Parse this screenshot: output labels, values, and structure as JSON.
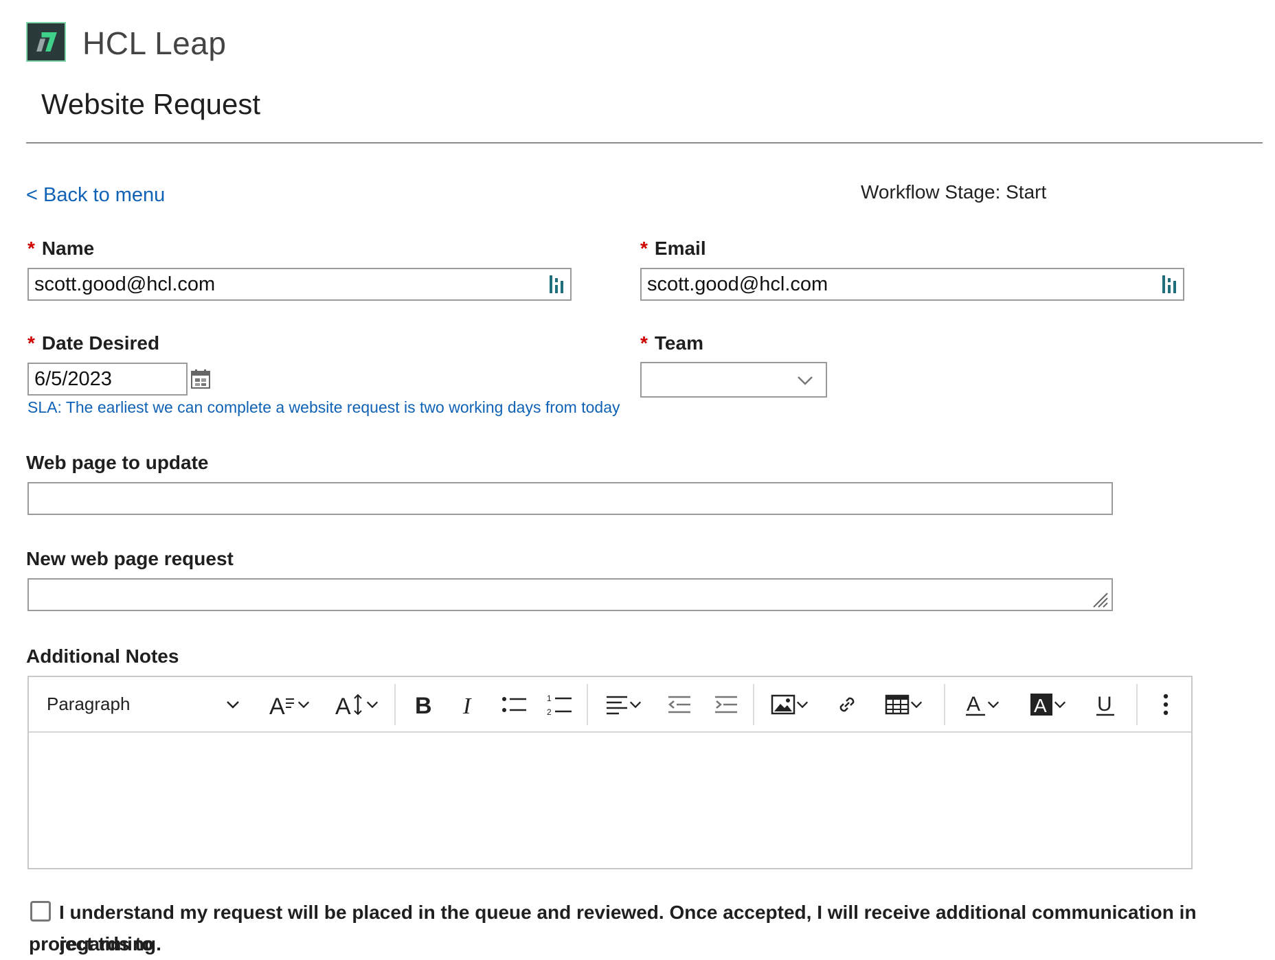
{
  "header": {
    "brand": "HCL Leap",
    "title": "Website Request"
  },
  "nav": {
    "back_label": "< Back to menu",
    "workflow_stage": "Workflow Stage: Start"
  },
  "form": {
    "name": {
      "label": "Name",
      "required": "*",
      "value": "scott.good@hcl.com"
    },
    "email": {
      "label": "Email",
      "required": "*",
      "value": "scott.good@hcl.com"
    },
    "date_desired": {
      "label": "Date Desired",
      "required": "*",
      "value": "6/5/2023",
      "hint": "SLA: The earliest we can complete a website request is two working days from today"
    },
    "team": {
      "label": "Team",
      "required": "*",
      "value": ""
    },
    "web_page_to_update": {
      "label": "Web page to update",
      "value": ""
    },
    "new_web_page_request": {
      "label": "New web page request",
      "value": ""
    },
    "additional_notes": {
      "label": "Additional Notes",
      "toolbar": {
        "paragraph_label": "Paragraph"
      }
    },
    "acknowledgement": {
      "line1": "I understand my request will be placed in the queue and reviewed. Once accepted, I will receive additional communication in regards to",
      "line2": "project timing."
    }
  },
  "colors": {
    "link": "#0f62b5",
    "required": "#d10000",
    "border": "#9a9a9a"
  }
}
